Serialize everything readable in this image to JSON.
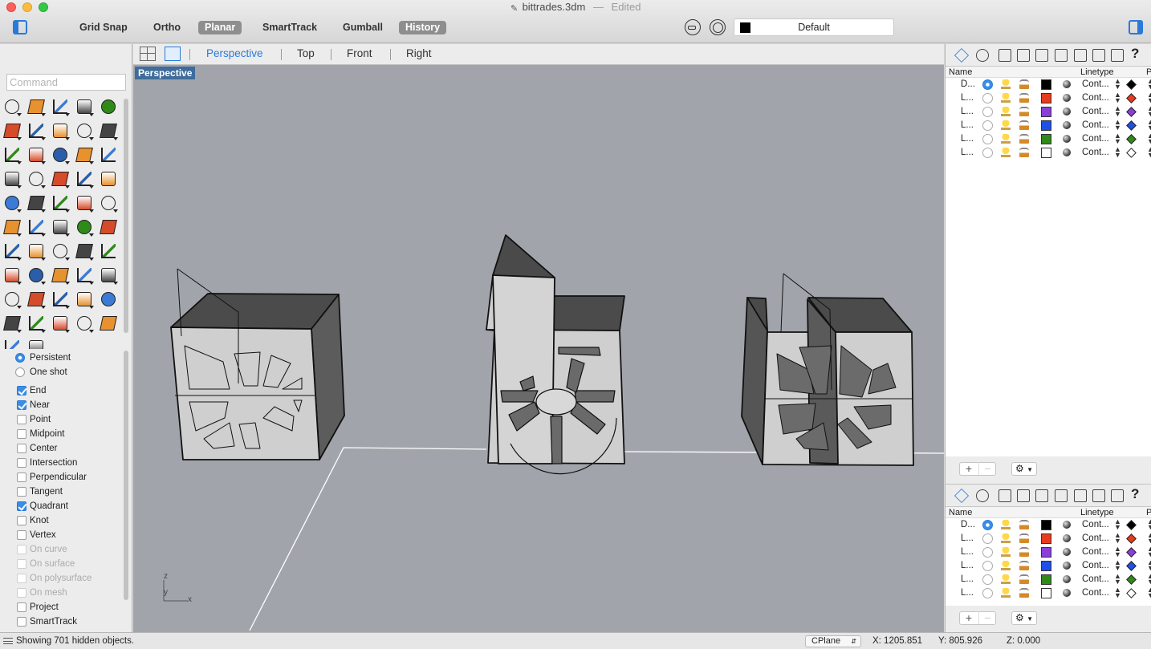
{
  "window": {
    "title": "bittrades.3dm",
    "edited": "Edited"
  },
  "toolbar": {
    "modes": [
      {
        "label": "Grid Snap",
        "on": false
      },
      {
        "label": "Ortho",
        "on": false
      },
      {
        "label": "Planar",
        "on": true
      },
      {
        "label": "SmartTrack",
        "on": false
      },
      {
        "label": "Gumball",
        "on": false
      },
      {
        "label": "History",
        "on": true
      }
    ],
    "layer_select": "Default"
  },
  "command": {
    "placeholder": "Command"
  },
  "osnap": {
    "modes": [
      {
        "label": "Persistent",
        "type": "radio",
        "on": true,
        "dim": false
      },
      {
        "label": "One shot",
        "type": "radio",
        "on": false,
        "dim": false
      }
    ],
    "items": [
      {
        "label": "End",
        "on": true,
        "dim": false
      },
      {
        "label": "Near",
        "on": true,
        "dim": false
      },
      {
        "label": "Point",
        "on": false,
        "dim": false
      },
      {
        "label": "Midpoint",
        "on": false,
        "dim": false
      },
      {
        "label": "Center",
        "on": false,
        "dim": false
      },
      {
        "label": "Intersection",
        "on": false,
        "dim": false
      },
      {
        "label": "Perpendicular",
        "on": false,
        "dim": false
      },
      {
        "label": "Tangent",
        "on": false,
        "dim": false
      },
      {
        "label": "Quadrant",
        "on": true,
        "dim": false
      },
      {
        "label": "Knot",
        "on": false,
        "dim": false
      },
      {
        "label": "Vertex",
        "on": false,
        "dim": false
      },
      {
        "label": "On curve",
        "on": false,
        "dim": true
      },
      {
        "label": "On surface",
        "on": false,
        "dim": true
      },
      {
        "label": "On polysurface",
        "on": false,
        "dim": true
      },
      {
        "label": "On mesh",
        "on": false,
        "dim": true
      },
      {
        "label": "Project",
        "on": false,
        "dim": false
      },
      {
        "label": "SmartTrack",
        "on": false,
        "dim": false
      }
    ]
  },
  "viewport_tabs": {
    "tabs": [
      "Perspective",
      "Top",
      "Front",
      "Right"
    ],
    "active": "Perspective"
  },
  "viewport": {
    "label": "Perspective",
    "axis_z": "z",
    "axis_y": "y",
    "axis_x": "x"
  },
  "layers_panel": {
    "col_name": "Name",
    "col_linetype": "Linetype",
    "col_p": "P",
    "rows": [
      {
        "name": "D...",
        "current": true,
        "color": "#000000",
        "linetype": "Cont...",
        "diamond": "#000000"
      },
      {
        "name": "L...",
        "current": false,
        "color": "#e63b1f",
        "linetype": "Cont...",
        "diamond": "#e63b1f"
      },
      {
        "name": "L...",
        "current": false,
        "color": "#8a3fd8",
        "linetype": "Cont...",
        "diamond": "#8a3fd8"
      },
      {
        "name": "L...",
        "current": false,
        "color": "#1f4fe6",
        "linetype": "Cont...",
        "diamond": "#1f4fe6"
      },
      {
        "name": "L...",
        "current": false,
        "color": "#2f8a1a",
        "linetype": "Cont...",
        "diamond": "#2f8a1a"
      },
      {
        "name": "L...",
        "current": false,
        "color": "#ffffff",
        "linetype": "Cont...",
        "diamond": "#ffffff"
      }
    ]
  },
  "status": {
    "message": "Showing 701 hidden objects.",
    "cplane": "CPlane",
    "x": "X: 1205.851",
    "y": "Y: 805.926",
    "z": "Z: 0.000"
  },
  "colors": {
    "accent": "#2a7ad8",
    "viewport_bg": "#a1a5ab",
    "viewport_label_bg": "#3f6c9b"
  }
}
